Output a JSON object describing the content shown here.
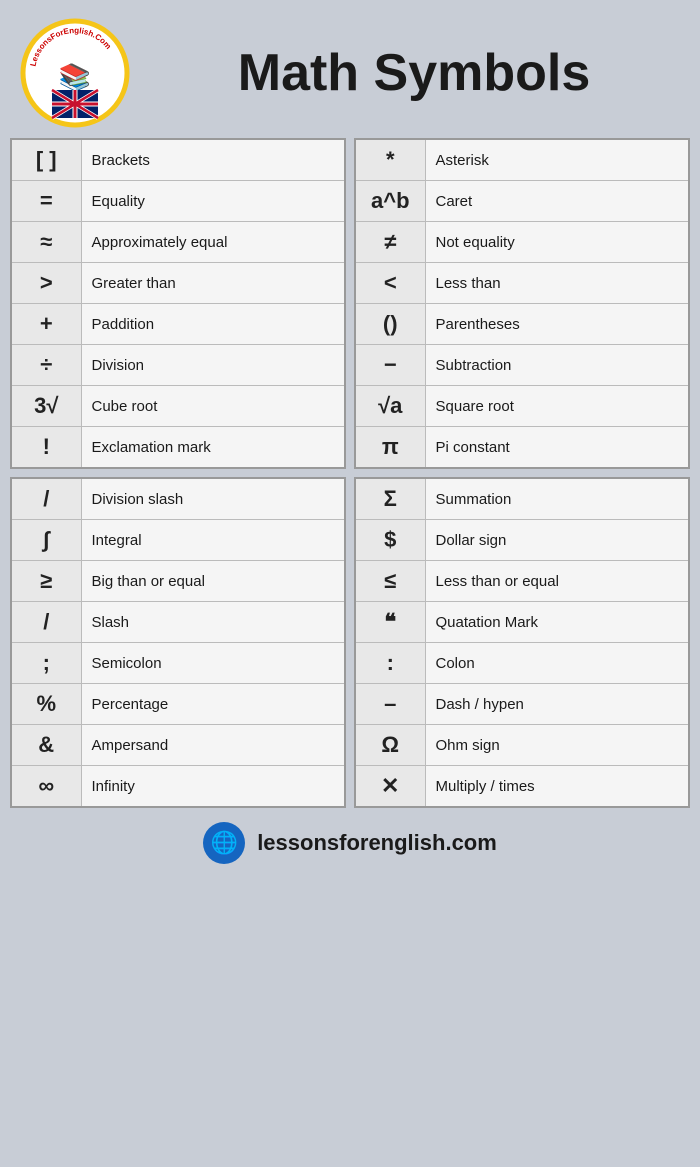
{
  "header": {
    "title": "Math Symbols",
    "logo_url": "LessonsForEnglish.Com",
    "footer_text": "lessonsforenglish.com"
  },
  "table1": {
    "rows": [
      {
        "symbol": "[ ]",
        "name": "Brackets"
      },
      {
        "symbol": "=",
        "name": "Equality"
      },
      {
        "symbol": "≈",
        "name": "Approximately equal"
      },
      {
        "symbol": ">",
        "name": "Greater than"
      },
      {
        "symbol": "+",
        "name": "Paddition"
      },
      {
        "symbol": "÷",
        "name": "Division"
      },
      {
        "symbol": "3√",
        "name": "Cube root"
      },
      {
        "symbol": "!",
        "name": "Exclamation mark"
      }
    ]
  },
  "table2": {
    "rows": [
      {
        "symbol": "*",
        "name": "Asterisk"
      },
      {
        "symbol": "a^b",
        "name": "Caret"
      },
      {
        "symbol": "≠",
        "name": "Not equality"
      },
      {
        "symbol": "<",
        "name": "Less than"
      },
      {
        "symbol": "()",
        "name": "Parentheses"
      },
      {
        "symbol": "−",
        "name": "Subtraction"
      },
      {
        "symbol": "√a",
        "name": "Square root"
      },
      {
        "symbol": "π",
        "name": "Pi constant"
      }
    ]
  },
  "table3": {
    "rows": [
      {
        "symbol": "/",
        "name": "Division slash"
      },
      {
        "symbol": "∫",
        "name": "Integral"
      },
      {
        "symbol": "≥",
        "name": "Big than or equal"
      },
      {
        "symbol": "/",
        "name": "Slash"
      },
      {
        "symbol": ";",
        "name": "Semicolon"
      },
      {
        "symbol": "%",
        "name": "Percentage"
      },
      {
        "symbol": "&",
        "name": "Ampersand"
      },
      {
        "symbol": "∞",
        "name": "Infinity"
      }
    ]
  },
  "table4": {
    "rows": [
      {
        "symbol": "Σ",
        "name": "Summation"
      },
      {
        "symbol": "$",
        "name": "Dollar sign"
      },
      {
        "symbol": "≤",
        "name": "Less than or equal"
      },
      {
        "symbol": "❝",
        "name": "Quatation Mark"
      },
      {
        "symbol": ":",
        "name": "Colon"
      },
      {
        "symbol": "–",
        "name": "Dash / hypen"
      },
      {
        "symbol": "Ω",
        "name": "Ohm sign"
      },
      {
        "symbol": "✕",
        "name": "Multiply / times"
      }
    ]
  }
}
